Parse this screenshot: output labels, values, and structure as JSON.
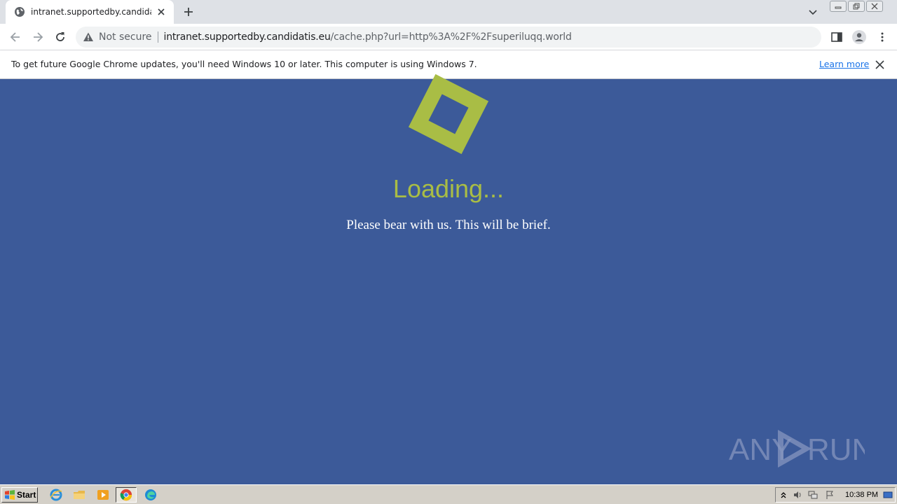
{
  "browser": {
    "tab": {
      "title": "intranet.supportedby.candidatis.eu/",
      "favicon": "globe-icon"
    },
    "omnibox": {
      "security_label": "Not secure",
      "url_host": "intranet.supportedby.candidatis.eu",
      "url_rest": "/cache.php?url=http%3A%2F%2Fsuperiluqq.world"
    },
    "infobar": {
      "message": "To get future Google Chrome updates, you'll need Windows 10 or later. This computer is using Windows 7.",
      "link": "Learn more"
    }
  },
  "page": {
    "heading": "Loading...",
    "subtext": "Please bear with us. This will be brief.",
    "colors": {
      "background": "#3c5a99",
      "accent": "#a9bd45",
      "text": "#ffffff"
    }
  },
  "watermark": {
    "text_left": "ANY",
    "text_right": "RUN"
  },
  "taskbar": {
    "start_label": "Start",
    "clock": "10:38 PM"
  }
}
